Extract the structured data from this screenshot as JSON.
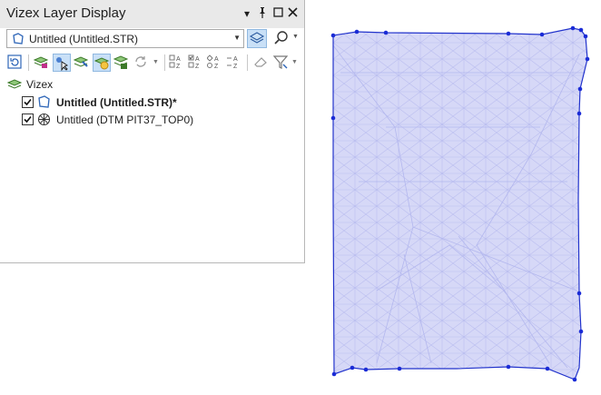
{
  "panel": {
    "title": "Vizex Layer Display",
    "controls": {
      "dropdown": "▾",
      "pin": "📌",
      "maximize": "□",
      "close": "✕"
    },
    "combo": {
      "value": "Untitled (Untitled.STR)"
    },
    "toolbar_sort_labels": [
      "A Z",
      "A Z",
      "A Z",
      "A Z"
    ]
  },
  "tree": {
    "root": {
      "label": "Vizex"
    },
    "layers": [
      {
        "label": "Untitled (Untitled.STR)*",
        "checked": true,
        "bold": true,
        "icon": "string-layer-icon"
      },
      {
        "label": "Untitled (DTM PIT37_TOP0)",
        "checked": true,
        "bold": false,
        "icon": "dtm-layer-icon"
      }
    ]
  },
  "colors": {
    "mesh_fill": "#d6d8f7",
    "mesh_edge": "#b3b7ee",
    "outline": "#2233cc",
    "vertex": "#1a2bd6",
    "title_bar": "#e9e9e9",
    "active_tool": "#c9e0f7"
  }
}
